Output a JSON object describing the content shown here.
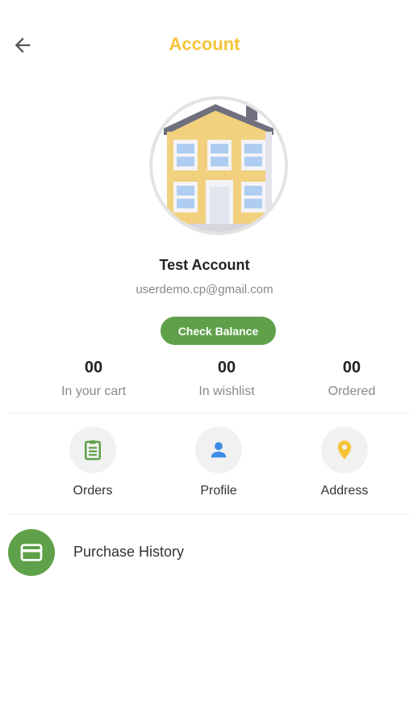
{
  "header": {
    "title": "Account",
    "back_icon": "arrow-left-icon",
    "title_color": "#f4c438"
  },
  "profile": {
    "name": "Test Account",
    "email": "userdemo.cp@gmail.com",
    "avatar_icon": "building-avatar"
  },
  "balance_button": {
    "label": "Check Balance",
    "color": "#5fa14a"
  },
  "stats": [
    {
      "value": "00",
      "label": "In your cart"
    },
    {
      "value": "00",
      "label": "In wishlist"
    },
    {
      "value": "00",
      "label": "Ordered"
    }
  ],
  "shortcuts": [
    {
      "label": "Orders",
      "icon": "clipboard-icon",
      "color": "#5fa14a"
    },
    {
      "label": "Profile",
      "icon": "person-icon",
      "color": "#3d8be6"
    },
    {
      "label": "Address",
      "icon": "location-pin-icon",
      "color": "#f4c438"
    }
  ],
  "menu": {
    "purchase_history": {
      "label": "Purchase History",
      "icon": "credit-card-icon"
    }
  }
}
